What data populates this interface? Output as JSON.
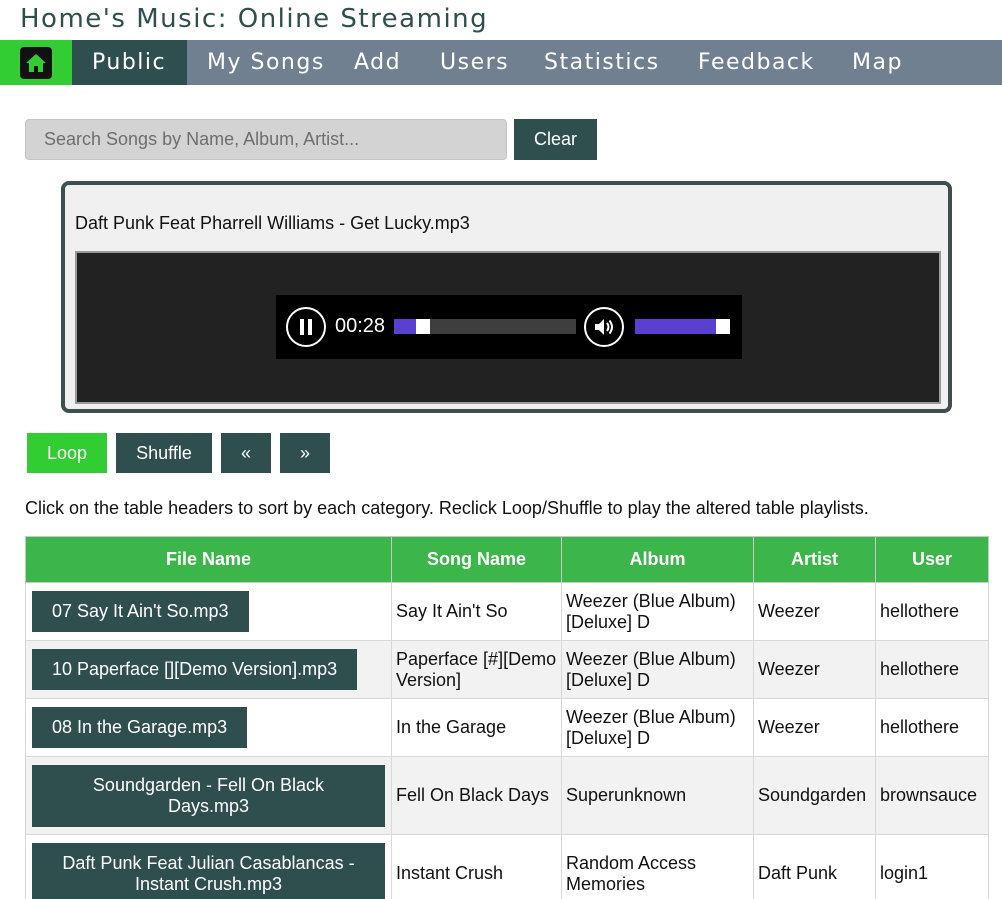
{
  "site_title": "Home's Music: Online Streaming",
  "nav": {
    "home_icon": "home-icon",
    "items": [
      "Public",
      "My Songs",
      "Add",
      "Users",
      "Statistics",
      "Feedback",
      "Map"
    ],
    "active": "Public"
  },
  "search": {
    "placeholder": "Search Songs by Name, Album, Artist...",
    "value": "",
    "clear_label": "Clear"
  },
  "player": {
    "now_playing": "Daft Punk Feat Pharrell Williams - Get Lucky.mp3",
    "state": "playing",
    "current_time": "00:28",
    "progress_percent": 8,
    "volume_percent": 90,
    "icons": [
      "pause-icon",
      "speaker-icon"
    ]
  },
  "controls": {
    "loop": "Loop",
    "shuffle": "Shuffle",
    "prev": "«",
    "next": "»"
  },
  "instructions": "Click on the table headers to sort by each category. Reclick Loop/Shuffle to play the altered table playlists.",
  "table": {
    "headers": [
      "File Name",
      "Song Name",
      "Album",
      "Artist",
      "User"
    ],
    "rows": [
      {
        "file": "07 Say It Ain't So.mp3",
        "song": "Say It Ain't So",
        "album": "Weezer (Blue Album) [Deluxe] D",
        "artist": "Weezer",
        "user": "hellothere"
      },
      {
        "file": "10 Paperface [][Demo Version].mp3",
        "song": "Paperface [#][Demo Version]",
        "album": "Weezer (Blue Album) [Deluxe] D",
        "artist": "Weezer",
        "user": "hellothere"
      },
      {
        "file": "08 In the Garage.mp3",
        "song": "In the Garage",
        "album": "Weezer (Blue Album) [Deluxe] D",
        "artist": "Weezer",
        "user": "hellothere"
      },
      {
        "file": "Soundgarden - Fell On Black Days.mp3",
        "song": "Fell On Black Days",
        "album": "Superunknown",
        "artist": "Soundgarden",
        "user": "brownsauce"
      },
      {
        "file": "Daft Punk Feat Julian Casablancas - Instant Crush.mp3",
        "song": "Instant Crush",
        "album": "Random Access Memories",
        "artist": "Daft Punk",
        "user": "login1"
      }
    ]
  },
  "colors": {
    "accent_green": "#32cd32",
    "header_green": "#3cb64a",
    "dark_slate": "#2f4f4f",
    "nav_gray": "#708090",
    "progress_purple": "#5b3fd0"
  }
}
